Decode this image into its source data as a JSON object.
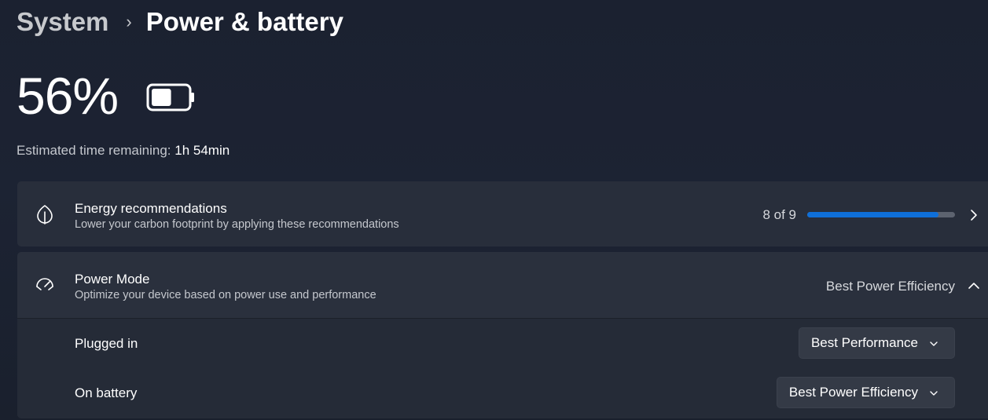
{
  "breadcrumb": {
    "parent": "System",
    "separator": "›",
    "current": "Power & battery"
  },
  "battery": {
    "percent_label": "56%",
    "level": 0.56,
    "icon": "battery-icon",
    "time_label": "Estimated time remaining:",
    "time_value": "1h 54min"
  },
  "energy": {
    "icon": "leaf-icon",
    "title": "Energy recommendations",
    "subtitle": "Lower your carbon footprint by applying these recommendations",
    "count_label": "8 of 9",
    "progress_fraction": 0.8889,
    "action_icon": "chevron-right-icon"
  },
  "power_mode": {
    "icon": "speedometer-icon",
    "title": "Power Mode",
    "subtitle": "Optimize your device based on power use and performance",
    "value": "Best Power Efficiency",
    "expand_icon": "chevron-up-icon",
    "rows": [
      {
        "label": "Plugged in",
        "selected": "Best Performance"
      },
      {
        "label": "On battery",
        "selected": "Best Power Efficiency"
      }
    ]
  },
  "colors": {
    "accent": "#0f6fd8",
    "background": "#1c2333",
    "card": "#2a303d"
  }
}
